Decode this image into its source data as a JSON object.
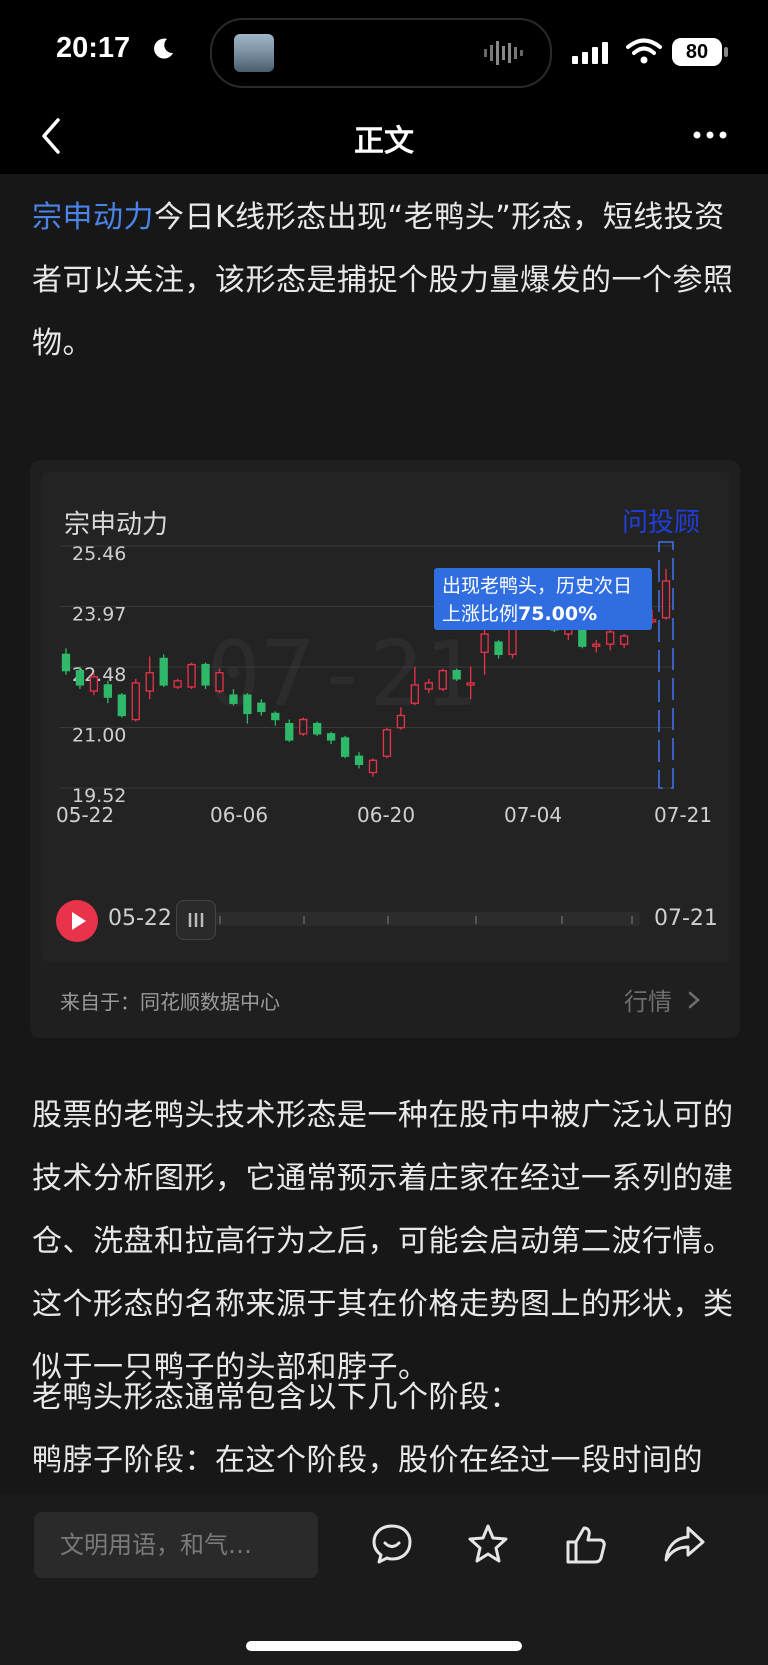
{
  "status_bar": {
    "time": "20:17",
    "battery": "80"
  },
  "nav": {
    "title": "正文"
  },
  "article": {
    "intro_link": "宗申动力",
    "intro_rest": "今日K线形态出现“老鸭头”形态，短线投资者可以关注，该形态是捕捉个股力量爆发的一个参照物。",
    "body_1": "股票的老鸭头技术形态是一种在股市中被广泛认可的技术分析图形，它通常预示着庄家在经过一系列的建仓、洗盘和拉高行为之后，可能会启动第二波行情。这个形态的名称来源于其在价格走势图上的形状，类似于一只鸭子的头部和脖子。",
    "body_2": "老鸭头形态通常包含以下几个阶段：",
    "body_3": "鸭脖子阶段：在这个阶段，股价在经过一段时间的"
  },
  "card": {
    "stock_name": "宗申动力",
    "ask_advisor": "问投顾",
    "source": "来自于：同花顺数据中心",
    "market_link": "行情",
    "range_start": "05-22",
    "range_end": "07-21"
  },
  "chart_data": {
    "type": "candlestick",
    "title": "宗申动力",
    "y_ticks": [
      "25.46",
      "23.97",
      "22.48",
      "21.00",
      "19.52"
    ],
    "y_range": [
      19.52,
      25.46
    ],
    "x_ticks": [
      "05-22",
      "06-06",
      "06-20",
      "07-04",
      "07-21"
    ],
    "watermark": "07-21",
    "annotation_line1": "出现老鸭头，历史次日",
    "annotation_line2": "上涨比例",
    "annotation_value": "75.00%",
    "up_color": "#e8334b",
    "down_color": "#2fb86a",
    "candles": [
      {
        "o": 22.8,
        "c": 22.4,
        "h": 22.95,
        "l": 22.3
      },
      {
        "o": 22.4,
        "c": 22.05,
        "h": 22.5,
        "l": 21.95
      },
      {
        "o": 21.9,
        "c": 22.25,
        "h": 22.35,
        "l": 21.8
      },
      {
        "o": 22.05,
        "c": 21.75,
        "h": 22.15,
        "l": 21.6
      },
      {
        "o": 21.8,
        "c": 21.3,
        "h": 21.85,
        "l": 21.25
      },
      {
        "o": 21.2,
        "c": 22.1,
        "h": 22.2,
        "l": 21.15
      },
      {
        "o": 21.9,
        "c": 22.35,
        "h": 22.75,
        "l": 21.7
      },
      {
        "o": 22.7,
        "c": 22.05,
        "h": 22.8,
        "l": 22.0
      },
      {
        "o": 22.0,
        "c": 22.15,
        "h": 22.2,
        "l": 21.95
      },
      {
        "o": 22.0,
        "c": 22.55,
        "h": 22.6,
        "l": 21.95
      },
      {
        "o": 22.55,
        "c": 22.05,
        "h": 22.6,
        "l": 21.95
      },
      {
        "o": 21.9,
        "c": 22.35,
        "h": 22.45,
        "l": 21.85
      },
      {
        "o": 21.8,
        "c": 21.6,
        "h": 21.95,
        "l": 21.55
      },
      {
        "o": 21.8,
        "c": 21.35,
        "h": 21.85,
        "l": 21.1
      },
      {
        "o": 21.6,
        "c": 21.4,
        "h": 21.7,
        "l": 21.3
      },
      {
        "o": 21.35,
        "c": 21.2,
        "h": 21.4,
        "l": 21.05
      },
      {
        "o": 21.1,
        "c": 20.7,
        "h": 21.2,
        "l": 20.65
      },
      {
        "o": 20.85,
        "c": 21.2,
        "h": 21.25,
        "l": 20.8
      },
      {
        "o": 21.1,
        "c": 20.85,
        "h": 21.15,
        "l": 20.8
      },
      {
        "o": 20.85,
        "c": 20.7,
        "h": 20.9,
        "l": 20.6
      },
      {
        "o": 20.75,
        "c": 20.3,
        "h": 20.8,
        "l": 20.25
      },
      {
        "o": 20.3,
        "c": 20.1,
        "h": 20.4,
        "l": 20.0
      },
      {
        "o": 19.9,
        "c": 20.2,
        "h": 20.25,
        "l": 19.8
      },
      {
        "o": 20.3,
        "c": 20.95,
        "h": 21.0,
        "l": 20.25
      },
      {
        "o": 21.0,
        "c": 21.3,
        "h": 21.5,
        "l": 20.95
      },
      {
        "o": 21.6,
        "c": 22.05,
        "h": 22.5,
        "l": 21.55
      },
      {
        "o": 21.95,
        "c": 22.1,
        "h": 22.2,
        "l": 21.85
      },
      {
        "o": 21.95,
        "c": 22.4,
        "h": 22.45,
        "l": 21.9
      },
      {
        "o": 22.4,
        "c": 22.2,
        "h": 22.45,
        "l": 22.15
      },
      {
        "o": 22.05,
        "c": 22.1,
        "h": 22.5,
        "l": 21.7
      },
      {
        "o": 22.85,
        "c": 23.3,
        "h": 24.0,
        "l": 22.3
      },
      {
        "o": 23.1,
        "c": 22.8,
        "h": 23.15,
        "l": 22.7
      },
      {
        "o": 22.8,
        "c": 23.7,
        "h": 24.4,
        "l": 22.7
      },
      {
        "o": 23.8,
        "c": 23.9,
        "h": 24.1,
        "l": 23.75
      },
      {
        "o": 23.95,
        "c": 23.65,
        "h": 24.0,
        "l": 23.55
      },
      {
        "o": 23.85,
        "c": 23.4,
        "h": 24.05,
        "l": 23.35
      },
      {
        "o": 23.3,
        "c": 23.5,
        "h": 23.6,
        "l": 23.15
      },
      {
        "o": 23.45,
        "c": 23.0,
        "h": 23.5,
        "l": 22.95
      },
      {
        "o": 23.0,
        "c": 23.05,
        "h": 23.15,
        "l": 22.85
      },
      {
        "o": 23.05,
        "c": 23.35,
        "h": 23.4,
        "l": 22.9
      },
      {
        "o": 23.05,
        "c": 23.25,
        "h": 23.3,
        "l": 22.95
      },
      {
        "o": 23.5,
        "c": 23.75,
        "h": 23.85,
        "l": 23.4
      },
      {
        "o": 23.6,
        "c": 23.65,
        "h": 23.9,
        "l": 23.55
      },
      {
        "o": 23.7,
        "c": 24.6,
        "h": 24.9,
        "l": 23.65
      }
    ]
  },
  "bottom_bar": {
    "comment_placeholder": "文明用语，和气…"
  }
}
